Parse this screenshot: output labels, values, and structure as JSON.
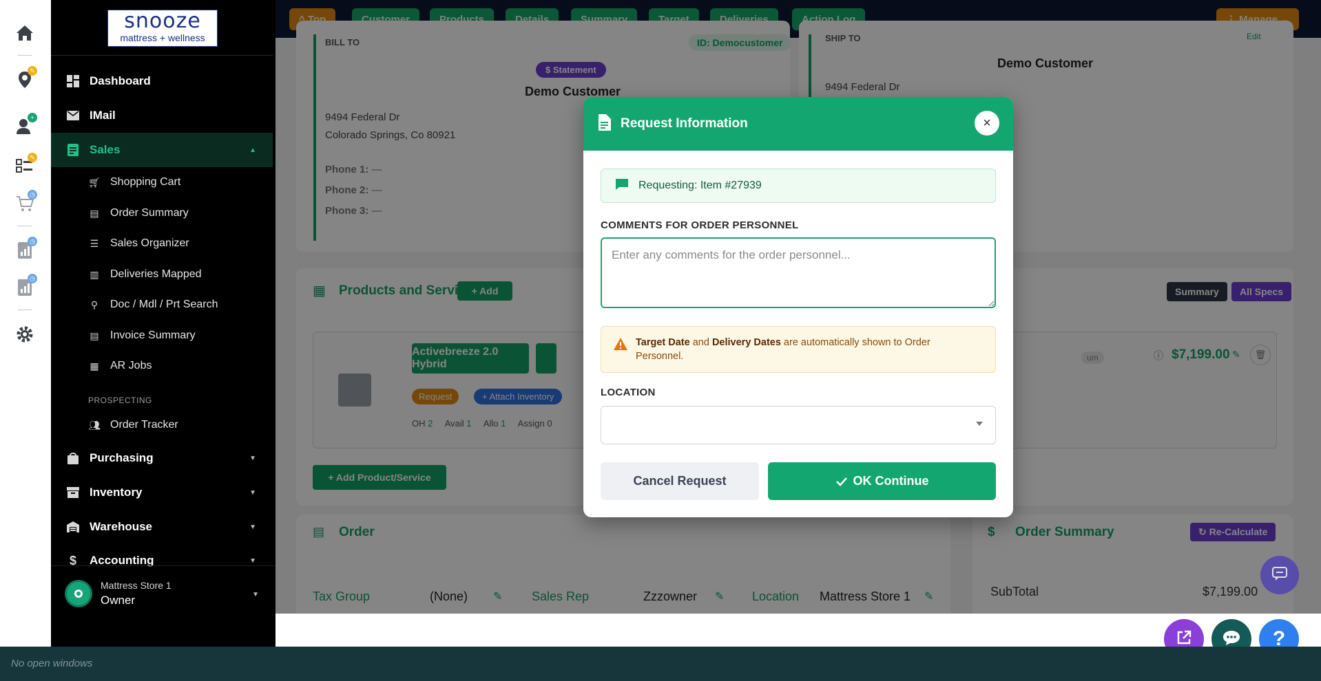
{
  "sidebar": {
    "logo_main": "snooze",
    "logo_sub": "mattress + wellness",
    "items": [
      {
        "label": "Dashboard"
      },
      {
        "label": "IMail"
      },
      {
        "label": "Sales"
      },
      {
        "label": "Purchasing"
      },
      {
        "label": "Inventory"
      },
      {
        "label": "Warehouse"
      },
      {
        "label": "Accounting"
      }
    ],
    "sales_sub": [
      {
        "label": "Shopping Cart",
        "icon": "cart-icon"
      },
      {
        "label": "Order Summary",
        "icon": "document-icon"
      },
      {
        "label": "Sales Organizer",
        "icon": "list-icon"
      },
      {
        "label": "Deliveries Mapped",
        "icon": "map-icon"
      },
      {
        "label": "Doc / Mdl / Prt Search",
        "icon": "search-icon"
      },
      {
        "label": "Invoice Summary",
        "icon": "document-icon"
      },
      {
        "label": "AR Jobs",
        "icon": "building-icon"
      }
    ],
    "section_prospecting": "PROSPECTING",
    "prospecting_item": "Order Tracker",
    "user_store": "Mattress Store 1",
    "user_role": "Owner"
  },
  "topbar": {
    "top": "^ Top",
    "tabs": [
      "Customer",
      "Products",
      "Details",
      "Summary",
      "Target",
      "Deliveries",
      "Action Log"
    ],
    "manage": "⋮ Manage ⌄"
  },
  "background": {
    "bill_to": "BILL TO",
    "customer_id": "ID: Democustomer",
    "statement": "$ Statement",
    "customer_name": "Demo Customer",
    "address1": "9494 Federal Dr",
    "address2": "Colorado Springs, Co 80921",
    "phone1": "Phone 1:",
    "phone2": "Phone 2:",
    "phone3": "Phone 3:",
    "phone_value": "—",
    "ship_to": "SHIP TO",
    "edit": "Edit",
    "ship_name": "Demo Customer",
    "ship_address": "9494 Federal Dr",
    "products_title": "Products and Services",
    "add": "+ Add",
    "summary_btn": "Summary",
    "all_specs_btn": "All Specs",
    "product_name": "Activebreeze 2.0 Hybrid",
    "request_tag": "Request",
    "attach_inventory": "+ Attach Inventory",
    "oh_label": "OH",
    "oh_value": "2",
    "avail_label": "Avail",
    "avail_value": "1",
    "allo_label": "Allo",
    "allo_value": "1",
    "assign_label": "Assign",
    "assign_value": "0",
    "price_tag": "um",
    "price": "$7,199.00",
    "add_product": "+ Add Product/Service",
    "order_title": "Order",
    "order_summary_title": "Order Summary",
    "recalculate": "Re-Calculate",
    "tax_group_label": "Tax Group",
    "tax_group_value": "(None)",
    "sales_rep_label": "Sales Rep",
    "sales_rep_value": "Zzzowner",
    "location_label": "Location",
    "location_value": "Mattress Store 1",
    "subtotal_label": "SubTotal",
    "subtotal_value": "$7,199.00"
  },
  "modal": {
    "title": "Request Information",
    "requesting": "Requesting: Item #27939",
    "comments_label": "COMMENTS FOR ORDER PERSONNEL",
    "comments_placeholder": "Enter any comments for the order personnel...",
    "warn_target": "Target Date",
    "warn_and": " and ",
    "warn_delivery": "Delivery Dates",
    "warn_rest": " are automatically shown to Order Personnel.",
    "location_label": "LOCATION",
    "location_value": "",
    "cancel": "Cancel Request",
    "ok": "OK Continue"
  },
  "taskbar": {
    "text": "No open windows"
  },
  "colors": {
    "brand_green": "#13a671",
    "sidebar_bg": "#000000",
    "topbar_bg": "#0d1730",
    "accent_purple": "#6d3fd1",
    "accent_orange": "#e08a12"
  }
}
